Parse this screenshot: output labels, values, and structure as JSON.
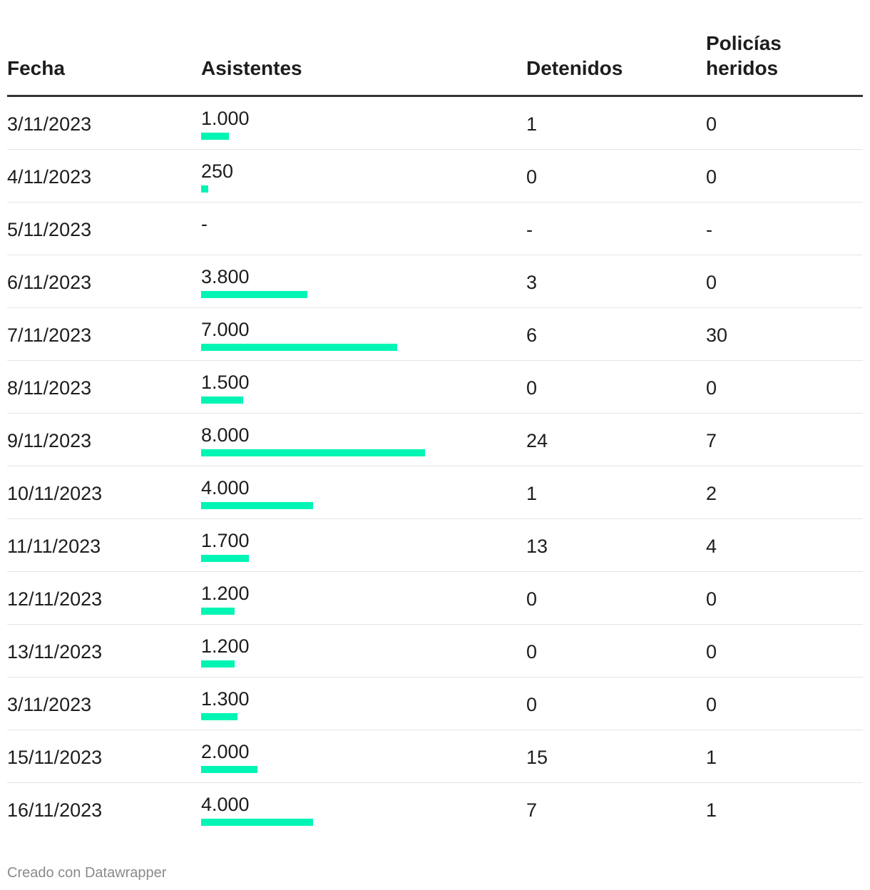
{
  "chart_data": {
    "type": "table",
    "columns": [
      "Fecha",
      "Asistentes",
      "Detenidos",
      "Policías heridos"
    ],
    "rows": [
      {
        "fecha": "3/11/2023",
        "asistentes_label": "1.000",
        "asistentes": 1000,
        "detenidos": "1",
        "policias": "0"
      },
      {
        "fecha": "4/11/2023",
        "asistentes_label": "250",
        "asistentes": 250,
        "detenidos": "0",
        "policias": "0"
      },
      {
        "fecha": "5/11/2023",
        "asistentes_label": "-",
        "asistentes": null,
        "detenidos": "-",
        "policias": "-"
      },
      {
        "fecha": "6/11/2023",
        "asistentes_label": "3.800",
        "asistentes": 3800,
        "detenidos": "3",
        "policias": "0"
      },
      {
        "fecha": "7/11/2023",
        "asistentes_label": "7.000",
        "asistentes": 7000,
        "detenidos": "6",
        "policias": "30"
      },
      {
        "fecha": "8/11/2023",
        "asistentes_label": "1.500",
        "asistentes": 1500,
        "detenidos": "0",
        "policias": "0"
      },
      {
        "fecha": "9/11/2023",
        "asistentes_label": "8.000",
        "asistentes": 8000,
        "detenidos": "24",
        "policias": "7"
      },
      {
        "fecha": "10/11/2023",
        "asistentes_label": "4.000",
        "asistentes": 4000,
        "detenidos": "1",
        "policias": "2"
      },
      {
        "fecha": "11/11/2023",
        "asistentes_label": "1.700",
        "asistentes": 1700,
        "detenidos": "13",
        "policias": "4"
      },
      {
        "fecha": "12/11/2023",
        "asistentes_label": "1.200",
        "asistentes": 1200,
        "detenidos": "0",
        "policias": "0"
      },
      {
        "fecha": "13/11/2023",
        "asistentes_label": "1.200",
        "asistentes": 1200,
        "detenidos": "0",
        "policias": "0"
      },
      {
        "fecha": "3/11/2023",
        "asistentes_label": "1.300",
        "asistentes": 1300,
        "detenidos": "0",
        "policias": "0"
      },
      {
        "fecha": "15/11/2023",
        "asistentes_label": "2.000",
        "asistentes": 2000,
        "detenidos": "15",
        "policias": "1"
      },
      {
        "fecha": "16/11/2023",
        "asistentes_label": "4.000",
        "asistentes": 4000,
        "detenidos": "7",
        "policias": "1"
      }
    ],
    "bar_max": 8000
  },
  "colors": {
    "bar": "#00f5b4",
    "header_rule": "#333333",
    "row_rule": "#e4e4e4",
    "footer_text": "#8a8a8a"
  },
  "header": {
    "fecha": "Fecha",
    "asistentes": "Asistentes",
    "detenidos": "Detenidos",
    "policias": "Policías heridos"
  },
  "footer": {
    "credit": "Creado con Datawrapper"
  }
}
